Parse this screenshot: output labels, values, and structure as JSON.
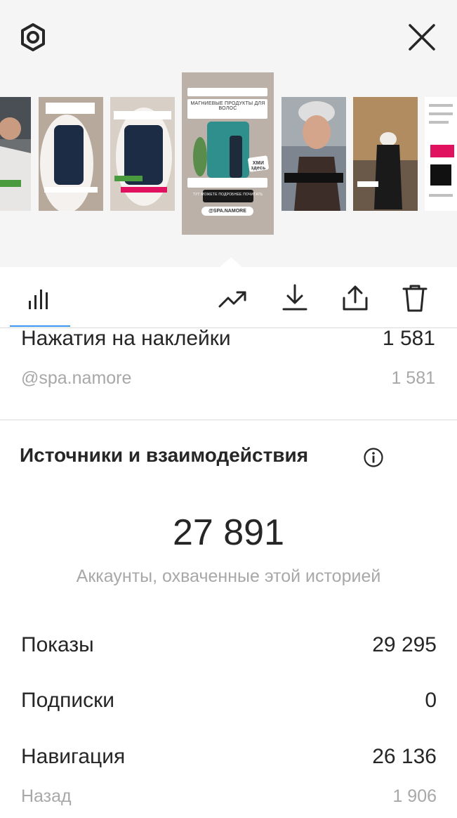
{
  "header": {
    "settings_icon": "gear-icon",
    "close_icon": "close-icon"
  },
  "selected_story": {
    "headline": "МАГНИЕВЫЕ ПРОДУКТЫ ДЛЯ ВОЛОС",
    "sticker_text": "ХМИ здесь",
    "cta": "ТУТ МОЖЕТЕ ПОДРОБНЕЕ ПОЧИТАТЬ",
    "mention": "@SPA.NAMORE"
  },
  "toolbar": {
    "insights_icon": "bar-chart-icon",
    "promote_icon": "trending-up-icon",
    "download_icon": "download-icon",
    "share_icon": "share-icon",
    "delete_icon": "trash-icon",
    "accent_color": "#3897f0"
  },
  "sticker_taps": {
    "label": "Нажатия на наклейки",
    "value": "1 581",
    "items": [
      {
        "label": "@spa.namore",
        "value": "1 581"
      }
    ]
  },
  "discovery": {
    "title": "Источники и взаимодействия",
    "info_icon": "info-icon",
    "accounts_reached": "27 891",
    "accounts_reached_label": "Аккаунты, охваченные этой историей",
    "metrics": [
      {
        "label": "Показы",
        "value": "29 295"
      },
      {
        "label": "Подписки",
        "value": "0"
      },
      {
        "label": "Навигация",
        "value": "26 136"
      },
      {
        "label": "Назад",
        "value": "1 906"
      }
    ]
  }
}
